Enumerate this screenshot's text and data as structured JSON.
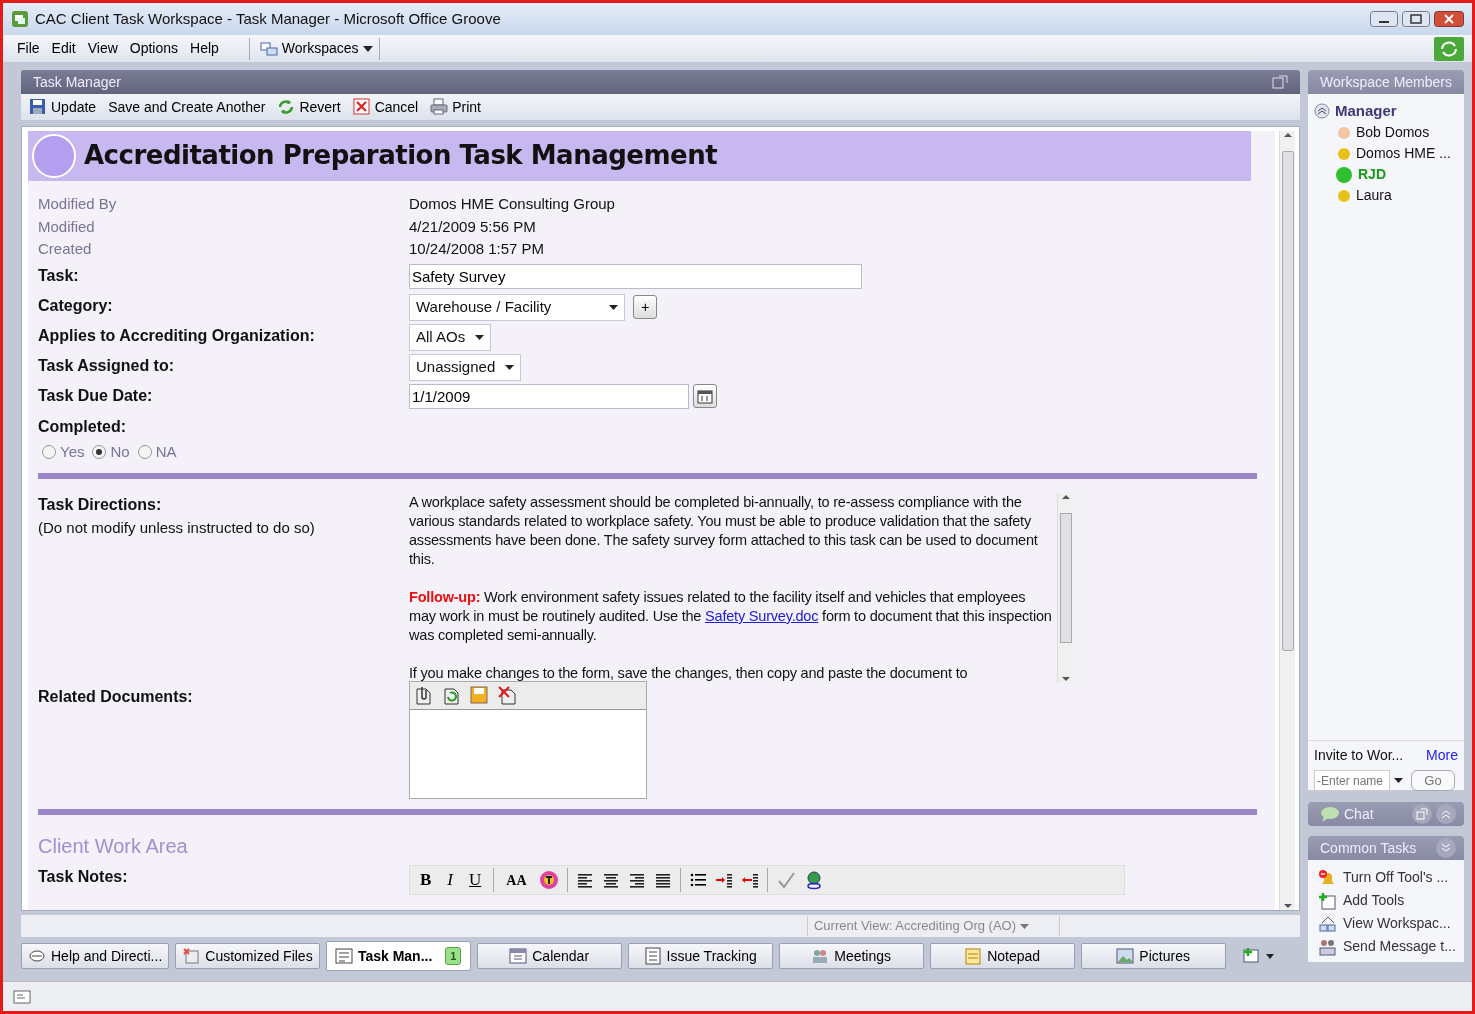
{
  "window": {
    "title": "CAC Client Task Workspace - Task Manager - Microsoft Office Groove"
  },
  "menu": [
    {
      "label": "File"
    },
    {
      "label": "Edit"
    },
    {
      "label": "View"
    },
    {
      "label": "Options"
    },
    {
      "label": "Help"
    }
  ],
  "workspaces_menu": {
    "label": "Workspaces"
  },
  "tool": {
    "title": "Task Manager",
    "actions": [
      {
        "kind": "save",
        "label": "Update"
      },
      {
        "kind": "plain",
        "label": "Save and Create Another"
      },
      {
        "kind": "revert",
        "label": "Revert"
      },
      {
        "kind": "cancel",
        "label": "Cancel"
      },
      {
        "kind": "print",
        "label": "Print"
      }
    ]
  },
  "form": {
    "title": "Accreditation Preparation Task Management",
    "info": [
      {
        "label": "Modified By",
        "value": "Domos HME Consulting Group"
      },
      {
        "label": "Modified",
        "value": "4/21/2009 5:56 PM"
      },
      {
        "label": "Created",
        "value": "10/24/2008 1:57 PM"
      }
    ],
    "fields": [
      {
        "kind": "text",
        "label": "Task:",
        "value": "Safety Survey"
      },
      {
        "kind": "select",
        "label": "Category:",
        "value": "Warehouse / Facility",
        "add_button": "+"
      },
      {
        "kind": "select",
        "label": "Applies to Accrediting Organization:",
        "value": "All AOs"
      },
      {
        "kind": "select",
        "label": "Task Assigned to:",
        "value": "Unassigned"
      },
      {
        "kind": "date",
        "label": "Task Due Date:",
        "value": "1/1/2009"
      }
    ],
    "completed": {
      "label": "Completed:",
      "options": [
        {
          "label": "Yes",
          "selected": false
        },
        {
          "label": "No",
          "selected": true
        },
        {
          "label": "NA",
          "selected": false
        }
      ]
    },
    "directions": {
      "label": "Task Directions:",
      "note": "(Do not modify unless instructed to do so)",
      "paragraphs": [
        [
          {
            "kind": "text",
            "text": "A workplace safety assessment should be completed bi-annually, to re-assess compliance with the various standards related to workplace safety.  You must be able to produce validation that the safety assessments have been done. The safety survey form attached to this task can be used to document this."
          }
        ],
        [
          {
            "kind": "alert",
            "text": "Follow-up:"
          },
          {
            "kind": "text",
            "text": " Work environment safety issues related to the facility itself and vehicles that employees may work in must be routinely audited.  Use the "
          },
          {
            "kind": "link",
            "text": "Safety Survey.doc"
          },
          {
            "kind": "text",
            "text": " form to document  that this inspection was completed semi-annually."
          }
        ],
        [
          {
            "kind": "text",
            "text": "If you make changes to the form, save the changes, then copy and paste the document to"
          }
        ]
      ]
    },
    "related_documents": {
      "label": "Related Documents:"
    },
    "client_work_area": {
      "title": "Client Work Area",
      "notes_label": "Task Notes:",
      "format_buttons": [
        {
          "kind": "bold",
          "label": "B"
        },
        {
          "kind": "italic",
          "label": "I"
        },
        {
          "kind": "underline",
          "label": "U"
        },
        {
          "kind": "size",
          "label": "AA"
        }
      ]
    }
  },
  "view_bar": {
    "label": "Current View: Accrediting Org (AO)"
  },
  "tool_tabs": [
    {
      "kind": "help",
      "label": "Help and Directi...",
      "selected": false
    },
    {
      "kind": "files",
      "label": "Customized Files",
      "selected": false
    },
    {
      "kind": "tasks",
      "label": "Task Man...",
      "selected": true,
      "badge": "1"
    },
    {
      "kind": "calendar",
      "label": "Calendar",
      "selected": false
    },
    {
      "kind": "issues",
      "label": "Issue Tracking",
      "selected": false
    },
    {
      "kind": "meetings",
      "label": "Meetings",
      "selected": false
    },
    {
      "kind": "notepad",
      "label": "Notepad",
      "selected": false
    },
    {
      "kind": "pictures",
      "label": "Pictures",
      "selected": false
    }
  ],
  "members": {
    "title": "Workspace Members",
    "groups": [
      {
        "label": "Manager",
        "expanded": true,
        "members": [
          {
            "name": "Bob Domos",
            "color": "#f6c6a4",
            "online": false
          },
          {
            "name": "Domos HME ...",
            "color": "#e8c21c",
            "online": false
          },
          {
            "name": "RJD",
            "color": "#2fbf2f",
            "online": true
          },
          {
            "name": "Laura",
            "color": "#e8c21c",
            "online": false
          }
        ]
      }
    ]
  },
  "invite": {
    "label": "Invite to Wor...",
    "more": "More",
    "placeholder": "-Enter name",
    "go": "Go"
  },
  "chat": {
    "title": "Chat"
  },
  "common_tasks": {
    "title": "Common Tasks",
    "items": [
      {
        "kind": "alert",
        "label": "Turn Off Tool's ..."
      },
      {
        "kind": "add",
        "label": "Add Tools"
      },
      {
        "kind": "view",
        "label": "View Workspac..."
      },
      {
        "kind": "message",
        "label": "Send Message t..."
      }
    ]
  }
}
